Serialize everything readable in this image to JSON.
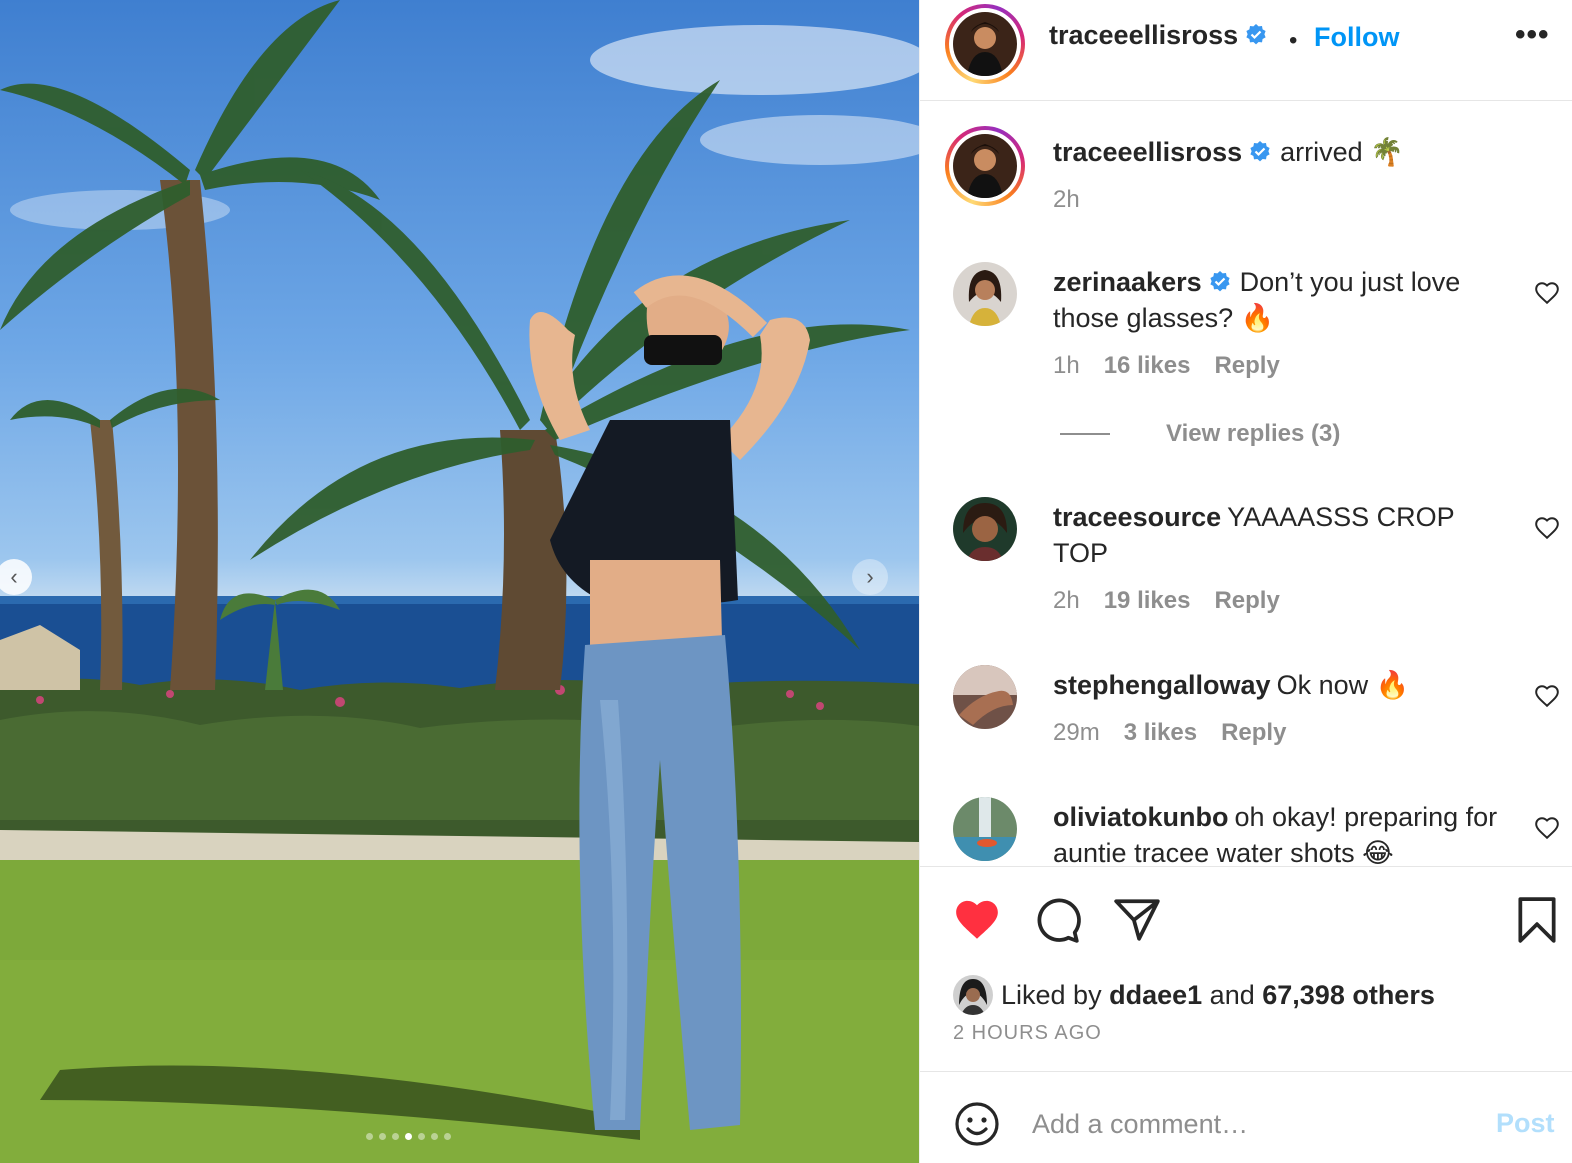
{
  "post": {
    "username": "traceeellisross",
    "follow_label": "Follow",
    "separator": "•",
    "more_label": "•••",
    "caption_text": "arrived 🌴",
    "caption_time": "2h",
    "photo_dots": {
      "count": 7,
      "active_index": 3
    }
  },
  "comments": [
    {
      "username": "zerinaakers",
      "verified": true,
      "text": "Don’t you just love those glasses? 🔥",
      "time": "1h",
      "likes": "16 likes",
      "reply": "Reply"
    },
    {
      "username": "traceesource",
      "verified": false,
      "text": "YAAAASSS CROP TOP",
      "time": "2h",
      "likes": "19 likes",
      "reply": "Reply"
    },
    {
      "username": "stephengalloway",
      "verified": false,
      "text": "Ok now 🔥",
      "time": "29m",
      "likes": "3 likes",
      "reply": "Reply"
    },
    {
      "username": "oliviatokunbo",
      "verified": false,
      "text": "oh okay! preparing for auntie tracee water shots 😂",
      "time": "",
      "likes": "",
      "reply": ""
    }
  ],
  "view_replies": "View replies (3)",
  "likes": {
    "prefix": "Liked by",
    "user": "ddaee1",
    "and": "and",
    "others": "67,398 others"
  },
  "timestamp": "2 HOURS AGO",
  "composer": {
    "placeholder": "Add a comment…",
    "post_label": "Post"
  },
  "colors": {
    "link_blue": "#0095f6",
    "like_red": "#ff3040",
    "verified_blue": "#3897f0",
    "muted_gray": "#8e8e8e"
  },
  "icons": {
    "like": "heart-filled-icon",
    "comment": "speech-bubble-icon",
    "share": "paper-plane-icon",
    "save": "bookmark-icon",
    "emoji": "smiley-icon"
  }
}
